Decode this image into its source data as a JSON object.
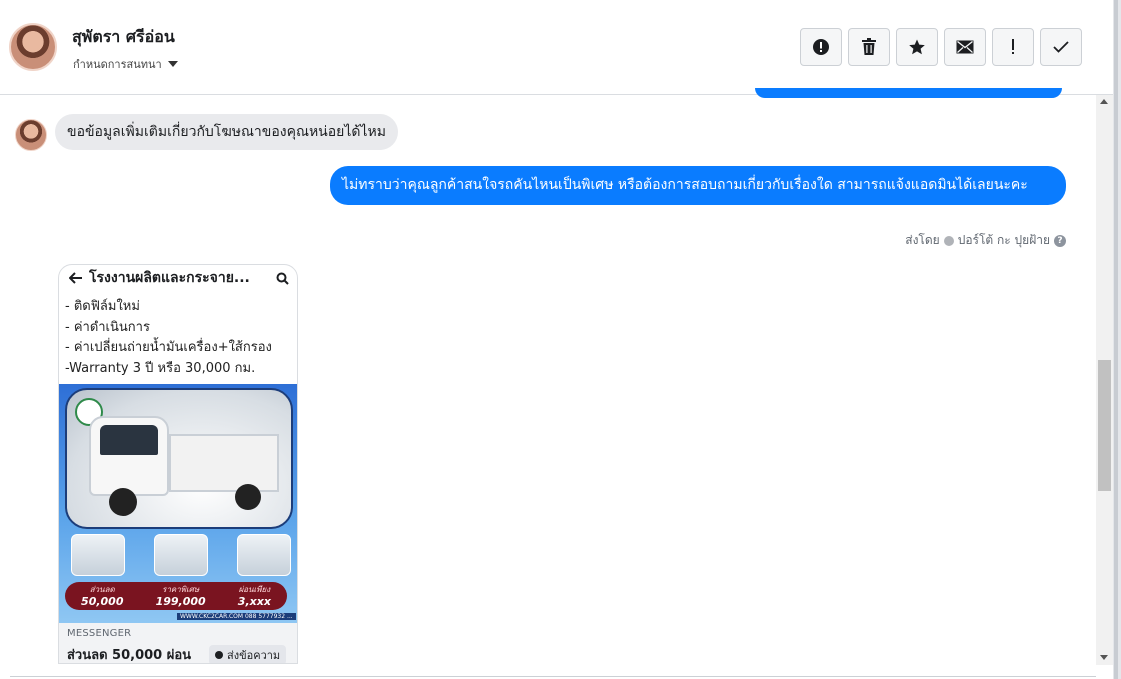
{
  "header": {
    "name": "สุพัตรา ศรีอ่อน",
    "subtitle": "กำหนดการสนทนา",
    "tools": [
      {
        "name": "spam-icon",
        "glyph": "!"
      },
      {
        "name": "trash-icon",
        "glyph": "🗑"
      },
      {
        "name": "star-icon",
        "glyph": "★"
      },
      {
        "name": "mail-icon",
        "glyph": "✉"
      },
      {
        "name": "exclamation-icon",
        "glyph": "!"
      },
      {
        "name": "check-icon",
        "glyph": "✓"
      }
    ]
  },
  "messages": {
    "incoming": "ขอข้อมูลเพิ่มเติมเกี่ยวกับโฆษณาของคุณหน่อยได้ไหม",
    "outgoing": "ไม่ทราบว่าคุณลูกค้าสนใจรถคันไหนเป็นพิเศษ หรือต้องการสอบถามเกี่ยวกับเรื่องใด สามารถแจ้งแอดมินได้เลยนะคะ",
    "sent_by_label": "ส่งโดย",
    "sent_by_name": "ปอร์โต้ กะ ปุยฝ้าย"
  },
  "card": {
    "title": "โรงงานผลิตและกระจาย...",
    "lines": [
      " - ติดฟิล์มใหม่",
      "  - ค่าดำเนินการ",
      "- ค่าเปลี่ยนถ่ายน้ำมันเครื่อง+ใส้กรอง",
      "-Warranty 3 ปี หรือ 30,000 กม."
    ],
    "prices": [
      {
        "label": "ส่วนลด",
        "value": "50,000"
      },
      {
        "label": "ราคาพิเศษ",
        "value": "199,000"
      },
      {
        "label": "ผ่อนเพียง",
        "value": "3,xxx"
      }
    ],
    "footer_strip": "WWW.CKC2CAR.COM 088 5777932 ...",
    "source": "MESSENGER",
    "caption": "ส่วนลด 50,000 ผ่อน",
    "send_button": "ส่งข้อความ"
  }
}
